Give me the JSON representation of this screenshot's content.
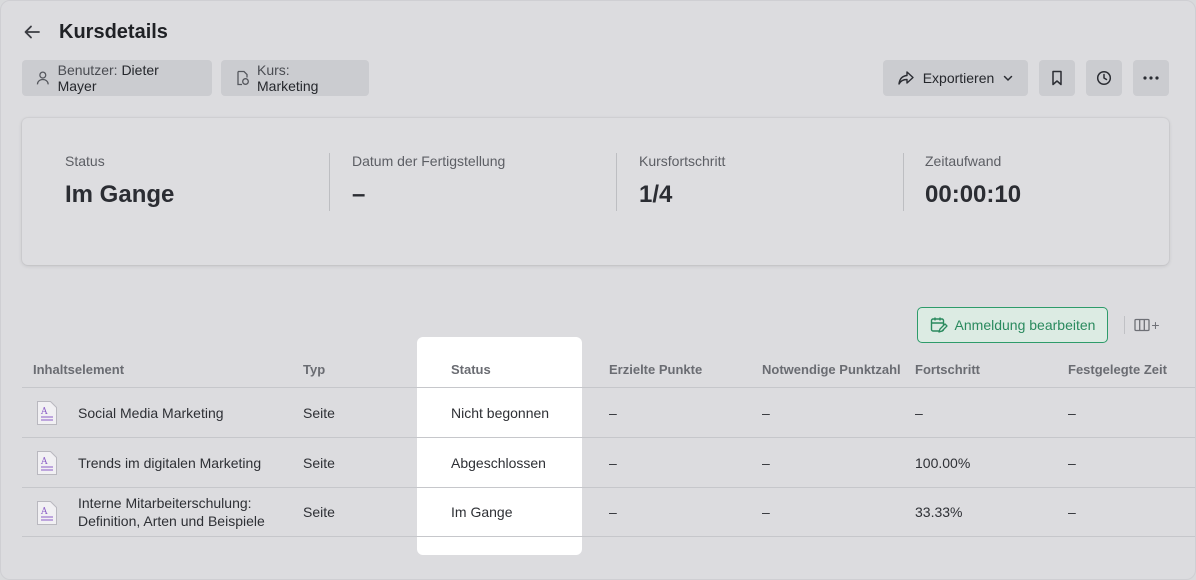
{
  "header": {
    "title": "Kursdetails",
    "user_chip": {
      "label": "Benutzer:",
      "value": "Dieter Mayer"
    },
    "course_chip": {
      "label": "Kurs:",
      "value": "Marketing"
    },
    "export_label": "Exportieren"
  },
  "summary": {
    "status": {
      "label": "Status",
      "value": "Im Gange"
    },
    "completion_date": {
      "label": "Datum der Fertigstellung",
      "value": "–"
    },
    "progress": {
      "label": "Kursfortschritt",
      "value": "1/4"
    },
    "time_spent": {
      "label": "Zeitaufwand",
      "value": "00:00:10"
    }
  },
  "actions": {
    "edit_enrollment": "Anmeldung bearbeiten",
    "columns_plus": "+"
  },
  "table": {
    "columns": [
      "Inhaltselement",
      "Typ",
      "Status",
      "Erzielte Punkte",
      "Notwendige Punktzahl",
      "Fortschritt",
      "Festgelegte Zeit"
    ],
    "rows": [
      {
        "item_line1": "Social Media Marketing",
        "item_line2": "",
        "type": "Seite",
        "status": "Nicht begonnen",
        "points": "–",
        "required": "–",
        "progress": "–",
        "time": "–"
      },
      {
        "item_line1": "Trends im digitalen Marketing",
        "item_line2": "",
        "type": "Seite",
        "status": "Abgeschlossen",
        "points": "–",
        "required": "–",
        "progress": "100.00%",
        "time": "–"
      },
      {
        "item_line1": "Interne Mitarbeiterschulung:",
        "item_line2": "Definition, Arten und Beispiele",
        "type": "Seite",
        "status": "Im Gange",
        "points": "–",
        "required": "–",
        "progress": "33.33%",
        "time": "–"
      }
    ]
  },
  "colors": {
    "accent_green": "#2e9b6a",
    "doc_icon_purple": "#8b5cc7"
  }
}
